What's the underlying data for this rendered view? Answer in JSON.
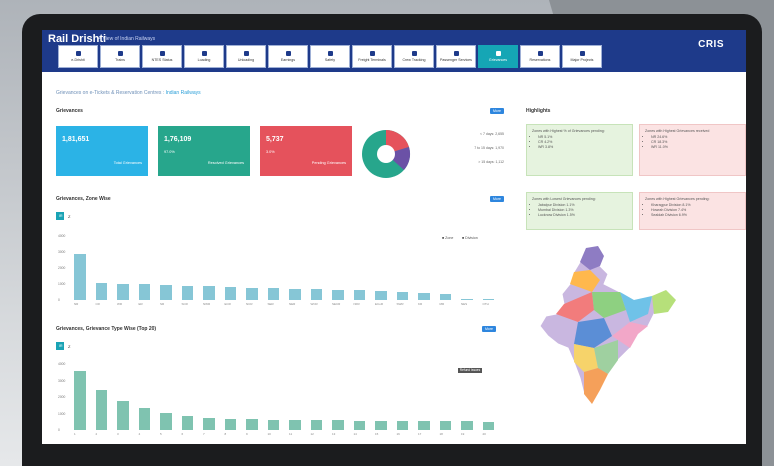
{
  "app": {
    "title": "Rail Drishti",
    "subtitle": "A View of Indian Railways",
    "brand": "CRIS"
  },
  "nav": [
    {
      "label": "e-Drishti",
      "icon": "dashboard-icon"
    },
    {
      "label": "Trains",
      "icon": "train-icon"
    },
    {
      "label": "NTES Status",
      "icon": "status-icon"
    },
    {
      "label": "Loading",
      "icon": "loading-icon"
    },
    {
      "label": "Unloading",
      "icon": "unloading-icon"
    },
    {
      "label": "Earnings",
      "icon": "earnings-icon"
    },
    {
      "label": "Safety",
      "icon": "safety-icon"
    },
    {
      "label": "Freight Terminals",
      "icon": "freight-icon"
    },
    {
      "label": "Crew Tracking",
      "icon": "crew-icon"
    },
    {
      "label": "Passenger Services",
      "icon": "passenger-icon"
    },
    {
      "label": "Grievances",
      "icon": "grievance-icon",
      "active": true
    },
    {
      "label": "Reservations",
      "icon": "reservation-icon"
    },
    {
      "label": "Major Projects",
      "icon": "projects-icon"
    }
  ],
  "breadcrumb": {
    "path": "Grievances on e-Tickets & Reservation Centres",
    "current": "Indian Railways"
  },
  "sections": {
    "grievances": "Grievances",
    "highlights": "Highlights",
    "zonewise": "Grievances, Zone Wise",
    "category": "Grievances, Grievance Type Wise (Top 20)",
    "more": "More"
  },
  "cards": [
    {
      "value": "1,81,651",
      "label": "Total Grievances",
      "meta": "",
      "color": "#2bb3e6"
    },
    {
      "value": "1,76,109",
      "label": "Resolved Grievances",
      "meta": "97.0%",
      "color": "#27a68c"
    },
    {
      "value": "5,737",
      "label": "Pending Grievances",
      "meta": "3.0%",
      "color": "#e5525c"
    }
  ],
  "pie_legend": [
    "< 7 days: 2,655",
    "7 to 15 days: 1,970",
    "> 15 days: 1,112"
  ],
  "highlights": [
    {
      "title": "Zones with Highest % of Grievances pending:",
      "items": [
        "NR 5.1%",
        "CR 4.2%",
        "WR 3.8%"
      ],
      "tone": "green"
    },
    {
      "title": "Zones with Highest Grievances received",
      "items": [
        "NR 24.6%",
        "CR 18.3%",
        "WR 11.0%"
      ],
      "tone": "red"
    },
    {
      "title": "Zones with Lowest Grievances pending:",
      "items": [
        "Jabalpur Division 1.1%",
        "Mumbai Division 1.3%",
        "Lucknow Division 1.5%"
      ],
      "tone": "green"
    },
    {
      "title": "Zones with Highest Grievances pending:",
      "items": [
        "Kharagpur Division 8.1%",
        "Howrah Division 7.4%",
        "Sealdah Division 6.9%"
      ],
      "tone": "red"
    }
  ],
  "zone_chart": {
    "toggles": [
      "IR",
      "Z"
    ],
    "legend": [
      "Zone",
      "Division"
    ],
    "yticks": [
      "4000",
      "3000",
      "2000",
      "1000",
      "0"
    ],
    "categories": [
      "NR",
      "CR",
      "WR",
      "ER",
      "SR",
      "SCR",
      "NWR",
      "ECR",
      "NCR",
      "SER",
      "NER",
      "WCR",
      "SECR",
      "NFR",
      "ECoR",
      "SWR",
      "KR",
      "MR",
      "NES",
      "OTH"
    ],
    "values": [
      2850,
      1080,
      1030,
      980,
      920,
      880,
      860,
      800,
      760,
      740,
      700,
      660,
      640,
      600,
      560,
      520,
      430,
      350,
      80,
      40
    ]
  },
  "type_chart": {
    "toggles": [
      "IR",
      "Z"
    ],
    "label": "Refund Issues",
    "yticks": [
      "4000",
      "3000",
      "2000",
      "1000",
      "0"
    ],
    "categories": [
      "1",
      "2",
      "3",
      "4",
      "5",
      "6",
      "7",
      "8",
      "9",
      "10",
      "11",
      "12",
      "13",
      "14",
      "15",
      "16",
      "17",
      "18",
      "19",
      "20"
    ],
    "values": [
      3600,
      2400,
      1780,
      1320,
      1050,
      830,
      750,
      680,
      640,
      620,
      600,
      590,
      580,
      570,
      560,
      550,
      540,
      530,
      520,
      510
    ]
  },
  "colors": {
    "header": "#1e3a8a",
    "accent": "#15a6b5",
    "pie": [
      "#27a68c",
      "#e5525c",
      "#6b51a6",
      "#2bb3e6"
    ]
  }
}
